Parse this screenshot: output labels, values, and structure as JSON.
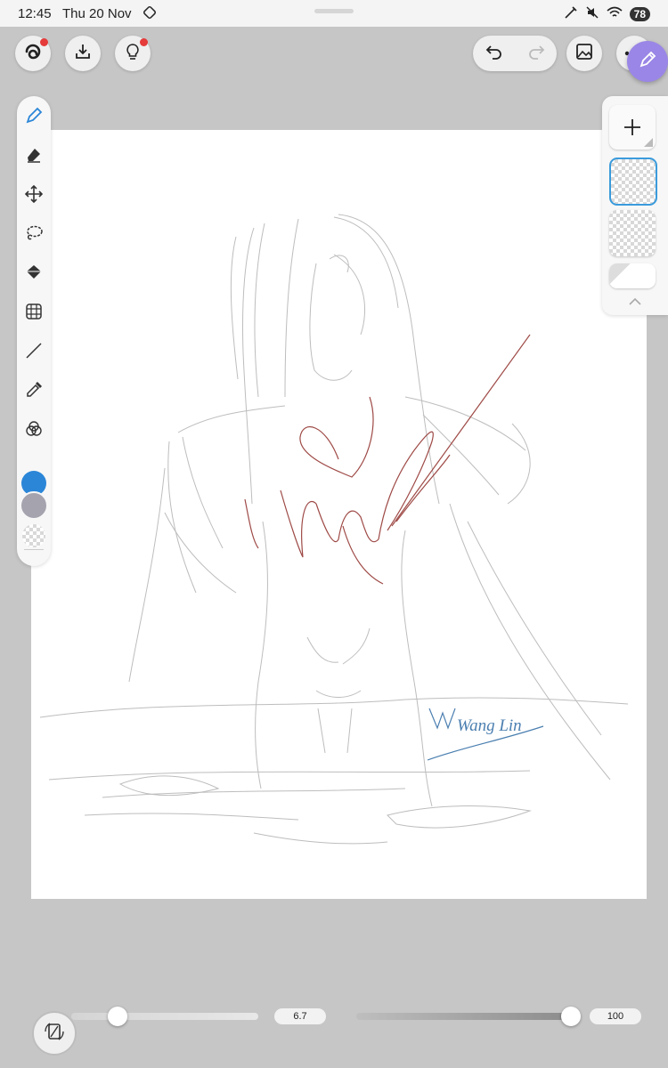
{
  "status": {
    "time": "12:45",
    "date": "Thu 20 Nov",
    "battery": "78"
  },
  "canvas": {
    "signature_text": "Wang Lin"
  },
  "size_slider": {
    "value": "6.7",
    "fraction": 0.22
  },
  "opacity_slider": {
    "value": "100",
    "fraction": 1.0
  },
  "colors": {
    "primary": "#2b86d8",
    "secondary": "#a4a3ae",
    "accent_dot": "#e53b3b",
    "pen_fab": "#9a86e6",
    "selected_layer_border": "#3a9bdc"
  },
  "icons": [
    "logo-icon",
    "import-icon",
    "lightbulb-icon",
    "undo-icon",
    "redo-icon",
    "gallery-icon",
    "more-icon",
    "pen-icon",
    "eraser-icon",
    "move-icon",
    "lasso-icon",
    "fill-icon",
    "transform-icon",
    "line-icon",
    "eyedropper-icon",
    "blend-icon",
    "add-layer-icon",
    "collapse-icon",
    "canvas-rotate-icon"
  ]
}
